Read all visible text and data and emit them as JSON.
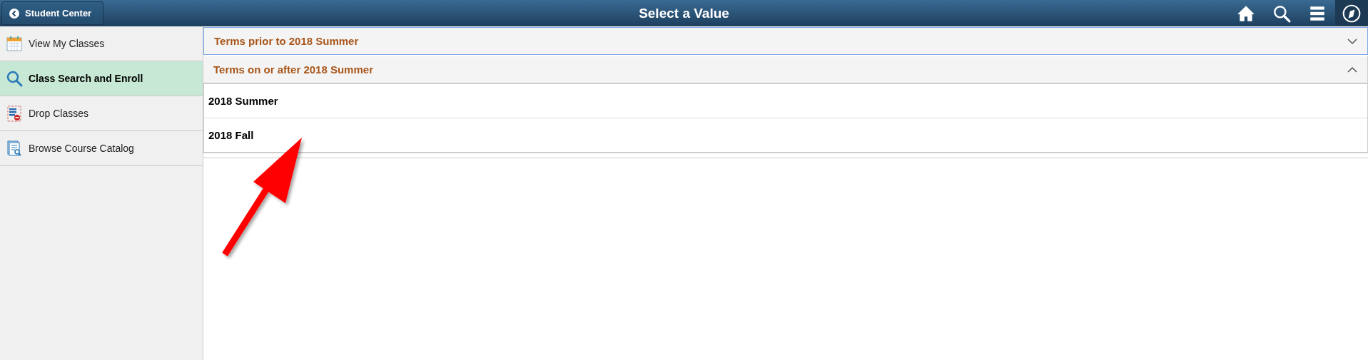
{
  "header": {
    "back_button": "Student Center",
    "title": "Select a Value"
  },
  "sidebar": {
    "items": [
      {
        "label": "View My Classes",
        "selected": false
      },
      {
        "label": "Class Search and Enroll",
        "selected": true
      },
      {
        "label": "Drop Classes",
        "selected": false
      },
      {
        "label": "Browse Course Catalog",
        "selected": false
      }
    ]
  },
  "sections": [
    {
      "title": "Terms prior to 2018 Summer",
      "expanded": false
    },
    {
      "title": "Terms on or after 2018 Summer",
      "expanded": true,
      "rows": [
        "2018 Summer",
        "2018 Fall"
      ]
    }
  ]
}
